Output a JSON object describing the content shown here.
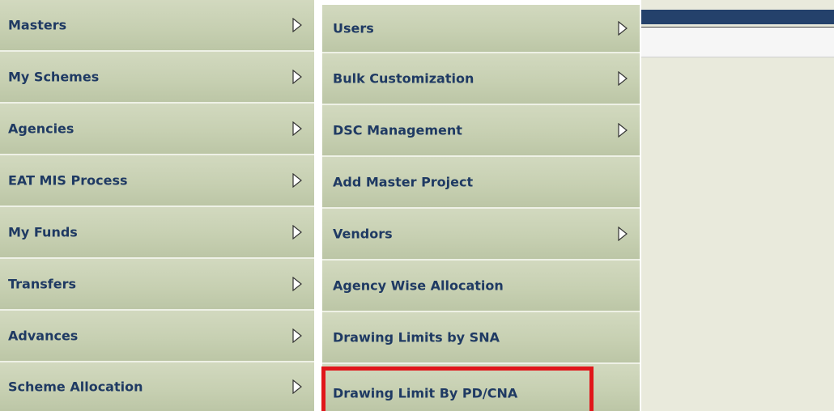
{
  "main_menu": {
    "items": [
      {
        "label": "Masters"
      },
      {
        "label": "My Schemes"
      },
      {
        "label": "Agencies"
      },
      {
        "label": "EAT MIS Process"
      },
      {
        "label": "My Funds"
      },
      {
        "label": "Transfers"
      },
      {
        "label": "Advances"
      },
      {
        "label": "Scheme Allocation"
      }
    ]
  },
  "submenu": {
    "items": [
      {
        "label": "Users"
      },
      {
        "label": "Bulk Customization"
      },
      {
        "label": "DSC Management"
      },
      {
        "label": "Add Master Project"
      },
      {
        "label": "Vendors"
      },
      {
        "label": "Agency Wise Allocation"
      },
      {
        "label": "Drawing Limits by SNA"
      },
      {
        "label": "Drawing Limit By PD/CNA"
      }
    ]
  },
  "colors": {
    "menu_text": "#1f3a63",
    "highlight_border": "#e0161a",
    "header_bar": "#24416b"
  },
  "icons": {
    "submenu_arrow": "chevron-right-outline-icon"
  }
}
